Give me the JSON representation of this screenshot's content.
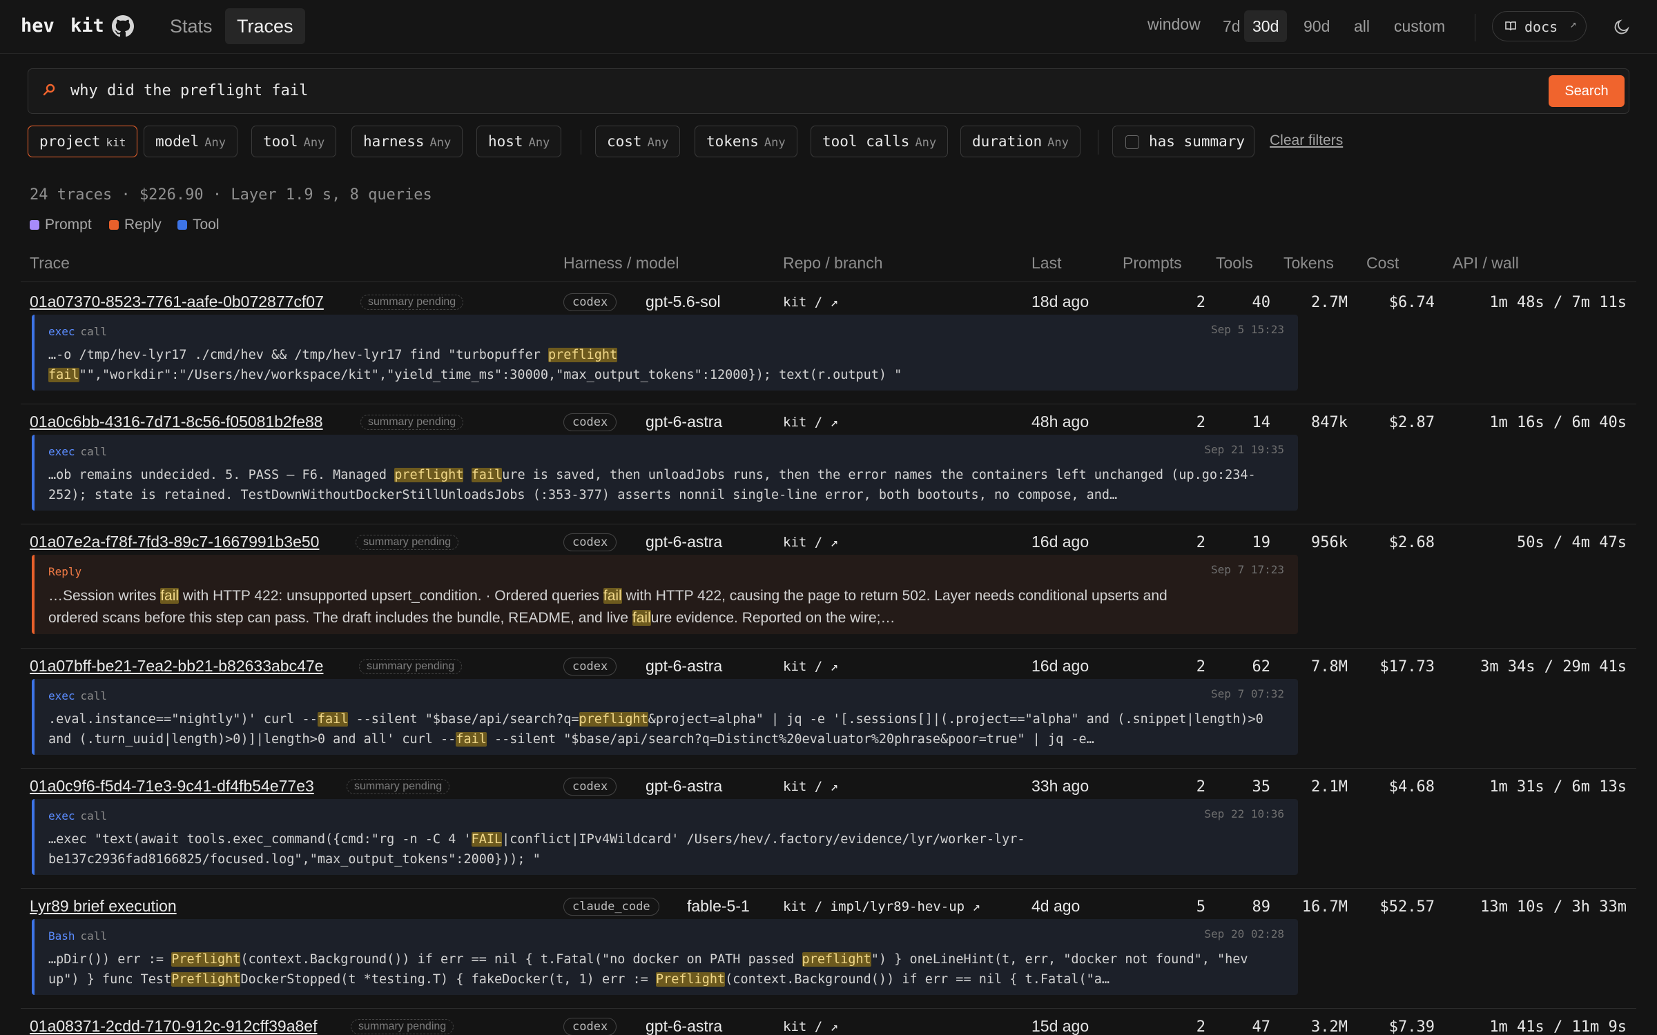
{
  "header": {
    "brand_left": "hev",
    "brand_right": "kit",
    "tabs": [
      "Stats",
      "Traces"
    ],
    "active_tab": "Traces",
    "window_label": "window",
    "windows": [
      "7d",
      "30d",
      "90d",
      "all",
      "custom"
    ],
    "active_window": "30d",
    "docs_label": "docs"
  },
  "search": {
    "query": "why did the preflight fail",
    "button": "Search"
  },
  "filters": [
    {
      "key": "project",
      "value": "kit",
      "active": true
    },
    {
      "key": "model",
      "value": "Any"
    },
    {
      "key": "tool",
      "value": "Any"
    },
    {
      "key": "harness",
      "value": "Any"
    },
    {
      "key": "host",
      "value": "Any"
    },
    {
      "key": "cost",
      "value": "Any"
    },
    {
      "key": "tokens",
      "value": "Any"
    },
    {
      "key": "tool calls",
      "value": "Any"
    },
    {
      "key": "duration",
      "value": "Any"
    }
  ],
  "has_summary_label": "has summary",
  "clear_filters": "Clear filters",
  "summary": "24 traces · $226.90 · Layer 1.9 s, 8 queries",
  "legend": [
    {
      "label": "Prompt",
      "color": "#a78bfa"
    },
    {
      "label": "Reply",
      "color": "#e8602b"
    },
    {
      "label": "Tool",
      "color": "#3d74e6"
    }
  ],
  "columns": [
    "Trace",
    "Harness / model",
    "Repo / branch",
    "Last",
    "Prompts",
    "Tools",
    "Tokens",
    "Cost",
    "API / wall"
  ],
  "rows": [
    {
      "trace": "01a07370-8523-7761-aafe-0b072877cf07",
      "badge": "summary pending",
      "harness": "codex",
      "model": "gpt-5.6-sol",
      "repo": "kit / ↗",
      "last": "18d ago",
      "prompts": "2",
      "tools": "40",
      "tokens": "2.7M",
      "cost": "$6.74",
      "api_wall": "1m 48s / 7m 11s",
      "snippet": {
        "type": "tool",
        "tag": "exec",
        "kind": "call",
        "ts": "Sep 5 15:23",
        "segments": [
          "…-o /tmp/hev-lyr17 ./cmd/hev && /tmp/hev-lyr17 find \"turbopuffer ",
          "[preflight]",
          "\n",
          "[fail]",
          "\"\",\"workdir\":\"/Users/hev/workspace/kit\",\"yield_time_ms\":30000,\"max_output_tokens\":12000}); text(r.output) \""
        ]
      }
    },
    {
      "trace": "01a0c6bb-4316-7d71-8c56-f05081b2fe88",
      "badge": "summary pending",
      "harness": "codex",
      "model": "gpt-6-astra",
      "repo": "kit / ↗",
      "last": "48h ago",
      "prompts": "2",
      "tools": "14",
      "tokens": "847k",
      "cost": "$2.87",
      "api_wall": "1m 16s / 6m 40s",
      "snippet": {
        "type": "tool",
        "tag": "exec",
        "kind": "call",
        "ts": "Sep 21 19:35",
        "segments": [
          "…ob remains undecided. 5. PASS — F6. Managed ",
          "[preflight]",
          " ",
          "[fail]",
          "ure is saved, then unloadJobs runs, then the error names the containers left unchanged (up.go:234-\n252); state is retained. TestDownWithoutDockerStillUnloadsJobs (:353-377) asserts nonnil single-line error, both bootouts, no compose, and…"
        ]
      }
    },
    {
      "trace": "01a07e2a-f78f-7fd3-89c7-1667991b3e50",
      "badge": "summary pending",
      "harness": "codex",
      "model": "gpt-6-astra",
      "repo": "kit / ↗",
      "last": "16d ago",
      "prompts": "2",
      "tools": "19",
      "tokens": "956k",
      "cost": "$2.68",
      "api_wall": "50s / 4m 47s",
      "snippet": {
        "type": "reply",
        "tag": "Reply",
        "kind": "",
        "ts": "Sep 7 17:23",
        "segments": [
          "…Session writes ",
          "[fail]",
          " with HTTP 422: unsupported upsert_condition. · Ordered queries ",
          "[fail]",
          " with HTTP 422, causing the page to return 502. Layer needs conditional upserts and\nordered scans before this step can pass. The draft includes the bundle, README, and live ",
          "[fail]",
          "ure evidence. Reported on the wire;…"
        ]
      }
    },
    {
      "trace": "01a07bff-be21-7ea2-bb21-b82633abc47e",
      "badge": "summary pending",
      "harness": "codex",
      "model": "gpt-6-astra",
      "repo": "kit / ↗",
      "last": "16d ago",
      "prompts": "2",
      "tools": "62",
      "tokens": "7.8M",
      "cost": "$17.73",
      "api_wall": "3m 34s / 29m 41s",
      "snippet": {
        "type": "tool",
        "tag": "exec",
        "kind": "call",
        "ts": "Sep 7 07:32",
        "segments": [
          ".eval.instance==\"nightly\")' curl --",
          "[fail]",
          " --silent \"$base/api/search?q=",
          "[preflight]",
          "&project=alpha\" | jq -e '[.sessions[]|(.project==\"alpha\" and (.snippet|length)>0\nand (.turn_uuid|length)>0)]|length>0 and all' curl --",
          "[fail]",
          " --silent \"$base/api/search?q=Distinct%20evaluator%20phrase&poor=true\" | jq -e…"
        ]
      }
    },
    {
      "trace": "01a0c9f6-f5d4-71e3-9c41-df4fb54e77e3",
      "badge": "summary pending",
      "harness": "codex",
      "model": "gpt-6-astra",
      "repo": "kit / ↗",
      "last": "33h ago",
      "prompts": "2",
      "tools": "35",
      "tokens": "2.1M",
      "cost": "$4.68",
      "api_wall": "1m 31s / 6m 13s",
      "snippet": {
        "type": "tool",
        "tag": "exec",
        "kind": "call",
        "ts": "Sep 22 10:36",
        "segments": [
          "…exec \"text(await tools.exec_command({cmd:\"rg -n -C 4 '",
          "[FAIL]",
          "|conflict|IPv4Wildcard' /Users/hev/.factory/evidence/lyr/worker-lyr-\nbe137c2936fad8166825/focused.log\",\"max_output_tokens\":2000})); \""
        ]
      }
    },
    {
      "trace": "Lyr89 brief execution",
      "badge": "",
      "harness": "claude_code",
      "model": "fable-5-1",
      "repo": "kit / impl/lyr89-hev-up ↗",
      "last": "4d ago",
      "prompts": "5",
      "tools": "89",
      "tokens": "16.7M",
      "cost": "$52.57",
      "api_wall": "13m 10s / 3h 33m",
      "snippet": {
        "type": "tool",
        "tag": "Bash",
        "kind": "call",
        "ts": "Sep 20 02:28",
        "segments": [
          "…pDir()) err := ",
          "[Preflight]",
          "(context.Background()) if err == nil { t.Fatal(\"no docker on PATH passed ",
          "[preflight]",
          "\") } oneLineHint(t, err, \"docker not found\", \"hev\nup\") } func Test",
          "[Preflight]",
          "DockerStopped(t *testing.T) { fakeDocker(t, 1) err := ",
          "[Preflight]",
          "(context.Background()) if err == nil { t.Fatal(\"a…"
        ]
      }
    },
    {
      "trace": "01a08371-2cdd-7170-912c-912cff39a8ef",
      "badge": "summary pending",
      "harness": "codex",
      "model": "gpt-6-astra",
      "repo": "kit / ↗",
      "last": "15d ago",
      "prompts": "2",
      "tools": "47",
      "tokens": "3.2M",
      "cost": "$7.39",
      "api_wall": "1m 41s / 11m 9s"
    }
  ]
}
